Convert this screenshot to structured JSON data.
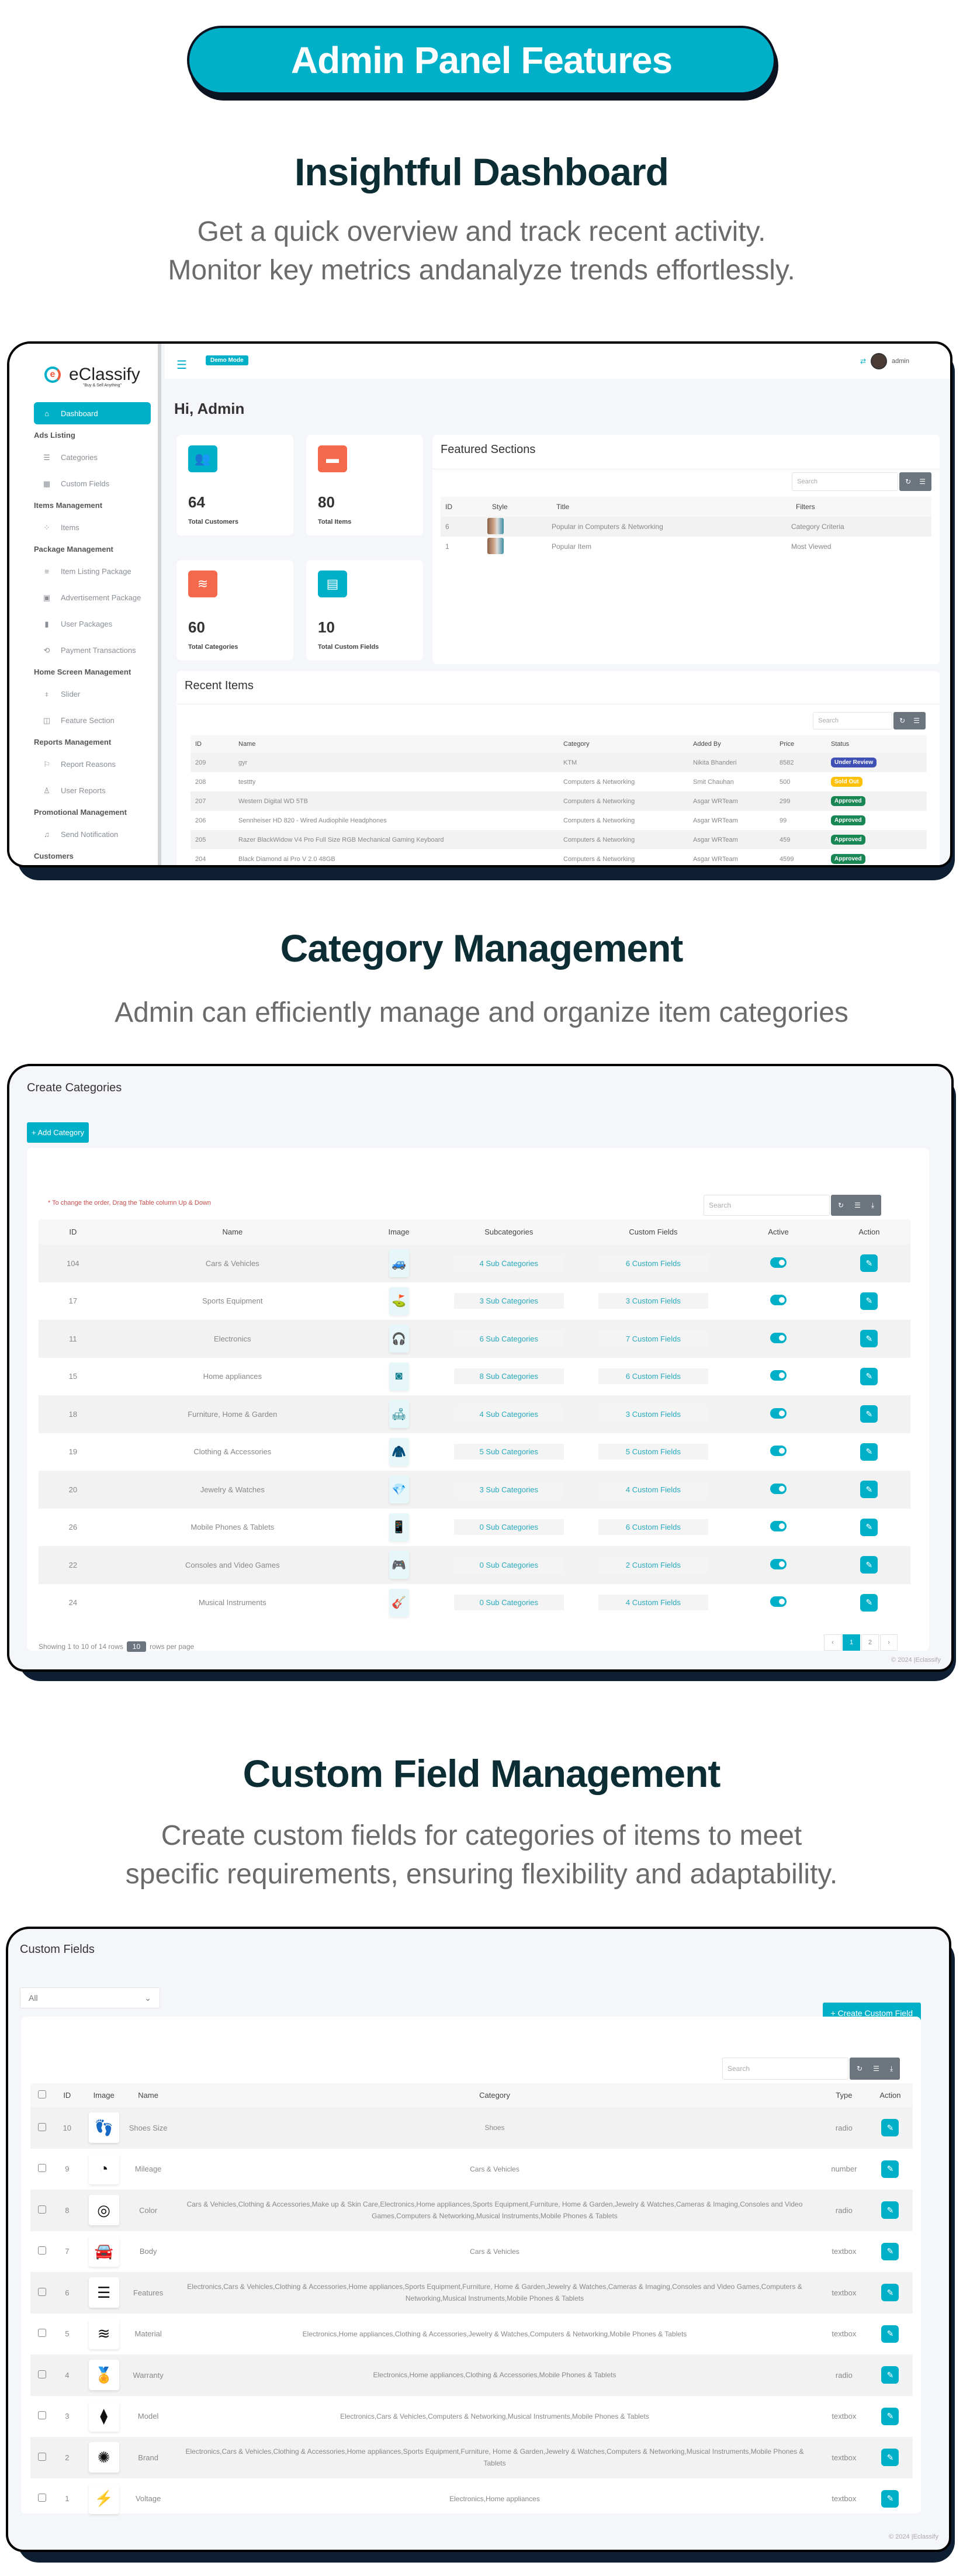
{
  "banner": {
    "title": "Admin Panel Features"
  },
  "sections": [
    {
      "title": "Insightful Dashboard",
      "subtitle_lines": [
        "Get a quick overview and track recent activity.",
        "Monitor key metrics andanalyze trends effortlessly."
      ]
    },
    {
      "title": "Category Management",
      "subtitle_lines": [
        "Admin can efficiently manage and organize item categories"
      ]
    },
    {
      "title": "Custom Field Management",
      "subtitle_lines": [
        "Create custom fields for categories of items to meet",
        "specific requirements, ensuring flexibility and adaptability."
      ]
    }
  ],
  "dashboard": {
    "logo": {
      "name": "eClassify",
      "tagline": "\"Buy & Sell Anything\""
    },
    "topbar": {
      "badge": "Demo Mode",
      "user": "admin"
    },
    "greeting": "Hi, Admin",
    "sidebar": [
      {
        "type": "item",
        "label": "Dashboard",
        "icon": "home-icon",
        "glyph": "⌂",
        "active": true
      },
      {
        "type": "head",
        "label": "Ads Listing"
      },
      {
        "type": "item",
        "label": "Categories",
        "icon": "list-icon",
        "glyph": "☰"
      },
      {
        "type": "item",
        "label": "Custom Fields",
        "icon": "grid-icon",
        "glyph": "▦"
      },
      {
        "type": "head",
        "label": "Items Management"
      },
      {
        "type": "item",
        "label": "Items",
        "icon": "circles-icon",
        "glyph": "⁘"
      },
      {
        "type": "head",
        "label": "Package Management"
      },
      {
        "type": "item",
        "label": "Item Listing Package",
        "icon": "lines-icon",
        "glyph": "≡"
      },
      {
        "type": "item",
        "label": "Advertisement Package",
        "icon": "ad-icon",
        "glyph": "▣"
      },
      {
        "type": "item",
        "label": "User Packages",
        "icon": "package-icon",
        "glyph": "▮"
      },
      {
        "type": "item",
        "label": "Payment Transactions",
        "icon": "payment-icon",
        "glyph": "⟲"
      },
      {
        "type": "head",
        "label": "Home Screen Management"
      },
      {
        "type": "item",
        "label": "Slider",
        "icon": "slider-icon",
        "glyph": "⧧"
      },
      {
        "type": "item",
        "label": "Feature Section",
        "icon": "layout-icon",
        "glyph": "◫"
      },
      {
        "type": "head",
        "label": "Reports Management"
      },
      {
        "type": "item",
        "label": "Report Reasons",
        "icon": "flag-icon",
        "glyph": "⚐"
      },
      {
        "type": "item",
        "label": "User Reports",
        "icon": "user-icon",
        "glyph": "♙"
      },
      {
        "type": "head",
        "label": "Promotional Management"
      },
      {
        "type": "item",
        "label": "Send Notification",
        "icon": "bell-icon",
        "glyph": "♫"
      },
      {
        "type": "head",
        "label": "Customers"
      }
    ],
    "stats": [
      {
        "value": "64",
        "label": "Total Customers",
        "icon": "users-icon",
        "glyph": "👥",
        "color": "#00b0c8"
      },
      {
        "value": "80",
        "label": "Total Items",
        "icon": "box-icon",
        "glyph": "▬",
        "color": "#f4694c"
      },
      {
        "value": "60",
        "label": "Total Categories",
        "icon": "layers-icon",
        "glyph": "≋",
        "color": "#f4694c"
      },
      {
        "value": "10",
        "label": "Total Custom Fields",
        "icon": "form-icon",
        "glyph": "▤",
        "color": "#00b0c8"
      }
    ],
    "featured": {
      "title": "Featured Sections",
      "search_placeholder": "Search",
      "columns": [
        "ID",
        "Style",
        "Title",
        "Filters"
      ],
      "rows": [
        {
          "id": "6",
          "title": "Popular in Computers & Networking",
          "filter": "Category Criteria"
        },
        {
          "id": "1",
          "title": "Popular Item",
          "filter": "Most Viewed"
        }
      ]
    },
    "recent": {
      "title": "Recent Items",
      "search_placeholder": "Search",
      "columns": [
        "ID",
        "Name",
        "Category",
        "Added By",
        "Price",
        "Status"
      ],
      "rows": [
        {
          "id": "209",
          "name": "gyr",
          "category": "KTM",
          "added_by": "Nikita Bhanderi",
          "price": "8582",
          "status": "Under Review",
          "status_color": "#3f51b5"
        },
        {
          "id": "208",
          "name": "testtty",
          "category": "Computers & Networking",
          "added_by": "Smit Chauhan",
          "price": "500",
          "status": "Sold Out",
          "status_color": "#ffc107"
        },
        {
          "id": "207",
          "name": "Western Digital WD 5TB",
          "category": "Computers & Networking",
          "added_by": "Asgar WRTeam",
          "price": "299",
          "status": "Approved",
          "status_color": "#198754"
        },
        {
          "id": "206",
          "name": "Sennheiser HD 820 - Wired Audiophile Headphones",
          "category": "Computers & Networking",
          "added_by": "Asgar WRTeam",
          "price": "99",
          "status": "Approved",
          "status_color": "#198754"
        },
        {
          "id": "205",
          "name": "Razer BlackWidow V4 Pro Full Size RGB Mechanical Gaming Keyboard",
          "category": "Computers & Networking",
          "added_by": "Asgar WRTeam",
          "price": "459",
          "status": "Approved",
          "status_color": "#198754"
        },
        {
          "id": "204",
          "name": "Black Diamond ai Pro V 2.0 48GB",
          "category": "Computers & Networking",
          "added_by": "Asgar WRTeam",
          "price": "4599",
          "status": "Approved",
          "status_color": "#198754"
        }
      ]
    }
  },
  "categories": {
    "title": "Create Categories",
    "add_button": "+ Add Category",
    "note": "* To change the order, Drag the Table column Up & Down",
    "search_placeholder": "Search",
    "columns": [
      "ID",
      "Name",
      "Image",
      "Subcategories",
      "Custom Fields",
      "Active",
      "Action"
    ],
    "rows": [
      {
        "id": "104",
        "name": "Cars & Vehicles",
        "icon": "car-icon",
        "glyph": "🚙",
        "sub": "4 Sub Categories",
        "cf": "6 Custom Fields",
        "active": true
      },
      {
        "id": "17",
        "name": "Sports Equipment",
        "icon": "golf-bag-icon",
        "glyph": "⛳",
        "sub": "3 Sub Categories",
        "cf": "3 Custom Fields",
        "active": true
      },
      {
        "id": "11",
        "name": "Electronics",
        "icon": "headphones-icon",
        "glyph": "🎧",
        "sub": "6 Sub Categories",
        "cf": "7 Custom Fields",
        "active": true
      },
      {
        "id": "15",
        "name": "Home appliances",
        "icon": "washing-machine-icon",
        "glyph": "◙",
        "sub": "8 Sub Categories",
        "cf": "6 Custom Fields",
        "active": true
      },
      {
        "id": "18",
        "name": "Furniture, Home & Garden",
        "icon": "sofa-icon",
        "glyph": "🛋",
        "sub": "4 Sub Categories",
        "cf": "3 Custom Fields",
        "active": true
      },
      {
        "id": "19",
        "name": "Clothing & Accessories",
        "icon": "coat-icon",
        "glyph": "🧥",
        "sub": "5 Sub Categories",
        "cf": "5 Custom Fields",
        "active": true
      },
      {
        "id": "20",
        "name": "Jewelry & Watches",
        "icon": "necklace-icon",
        "glyph": "💎",
        "sub": "3 Sub Categories",
        "cf": "4 Custom Fields",
        "active": true
      },
      {
        "id": "26",
        "name": "Mobile Phones & Tablets",
        "icon": "phone-icon",
        "glyph": "📱",
        "sub": "0 Sub Categories",
        "cf": "6 Custom Fields",
        "active": true
      },
      {
        "id": "22",
        "name": "Consoles and Video Games",
        "icon": "console-icon",
        "glyph": "🎮",
        "sub": "0 Sub Categories",
        "cf": "2 Custom Fields",
        "active": true
      },
      {
        "id": "24",
        "name": "Musical Instruments",
        "icon": "guitar-icon",
        "glyph": "🎸",
        "sub": "0 Sub Categories",
        "cf": "4 Custom Fields",
        "active": true
      }
    ],
    "footer": {
      "showing": "Showing 1 to 10 of 14 rows",
      "per_page": "10",
      "per_page_suffix": "rows per page",
      "pages": [
        "‹",
        "1",
        "2",
        "›"
      ],
      "current_page": "1"
    },
    "copyright": "© 2024 |Eclassify"
  },
  "custom_fields": {
    "title": "Custom Fields",
    "filter_value": "All",
    "create_button": "+ Create Custom Field",
    "search_placeholder": "Search",
    "columns": [
      "",
      "ID",
      "Image",
      "Name",
      "Category",
      "Type",
      "Action"
    ],
    "rows": [
      {
        "id": "10",
        "name": "Shoes Size",
        "icon": "foot-icon",
        "glyph": "👣",
        "category": "Shoes",
        "type": "radio"
      },
      {
        "id": "9",
        "name": "Mileage",
        "icon": "speedometer-icon",
        "glyph": "◔",
        "category": "Cars & Vehicles",
        "type": "number"
      },
      {
        "id": "8",
        "name": "Color",
        "icon": "color-wheel-icon",
        "glyph": "◎",
        "category": "Cars & Vehicles,Clothing & Accessories,Make up & Skin Care,Electronics,Home appliances,Sports Equipment,Furniture, Home & Garden,Jewelry & Watches,Cameras & Imaging,Consoles and Video Games,Computers & Networking,Musical Instruments,Mobile Phones & Tablets",
        "type": "radio"
      },
      {
        "id": "7",
        "name": "Body",
        "icon": "car-front-icon",
        "glyph": "🚘",
        "category": "Cars & Vehicles",
        "type": "textbox"
      },
      {
        "id": "6",
        "name": "Features",
        "icon": "star-list-icon",
        "glyph": "☰",
        "category": "Electronics,Cars & Vehicles,Clothing & Accessories,Home appliances,Sports Equipment,Furniture, Home & Garden,Jewelry & Watches,Cameras & Imaging,Consoles and Video Games,Computers & Networking,Musical Instruments,Mobile Phones & Tablets",
        "type": "textbox"
      },
      {
        "id": "5",
        "name": "Material",
        "icon": "layers-icon",
        "glyph": "≋",
        "category": "Electronics,Home appliances,Clothing & Accessories,Jewelry & Watches,Computers & Networking,Mobile Phones & Tablets",
        "type": "textbox"
      },
      {
        "id": "4",
        "name": "Warranty",
        "icon": "badge-shield-icon",
        "glyph": "🏅",
        "category": "Electronics,Home appliances,Clothing & Accessories,Mobile Phones & Tablets",
        "type": "radio"
      },
      {
        "id": "3",
        "name": "Model",
        "icon": "cube-network-icon",
        "glyph": "⧫",
        "category": "Electronics,Cars & Vehicles,Computers & Networking,Musical Instruments,Mobile Phones & Tablets",
        "type": "textbox"
      },
      {
        "id": "2",
        "name": "Brand",
        "icon": "brand-seal-icon",
        "glyph": "✺",
        "category": "Electronics,Cars & Vehicles,Clothing & Accessories,Home appliances,Sports Equipment,Furniture, Home & Garden,Jewelry & Watches,Computers & Networking,Musical Instruments,Mobile Phones & Tablets",
        "type": "textbox"
      },
      {
        "id": "1",
        "name": "Voltage",
        "icon": "voltage-icon",
        "glyph": "⚡",
        "category": "Electronics,Home appliances",
        "type": "textbox"
      }
    ],
    "copyright": "© 2024 |Eclassify"
  }
}
